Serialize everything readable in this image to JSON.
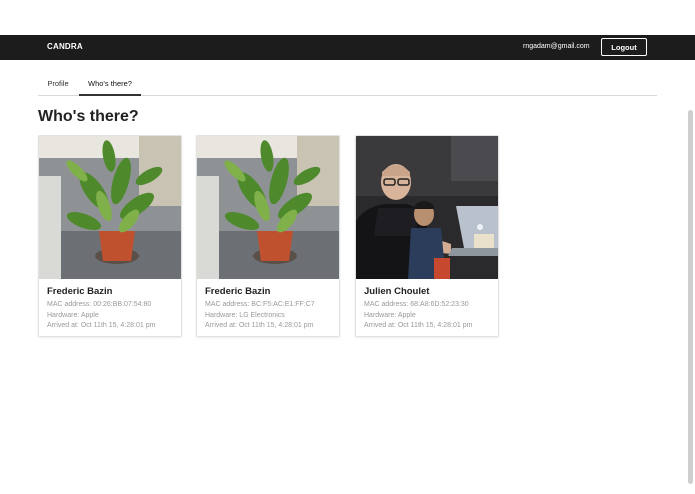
{
  "navbar": {
    "brand": "CANDRA",
    "user_email": "rngadam@gmail.com",
    "logout_label": "Logout"
  },
  "tabs": [
    {
      "label": "Profile",
      "active": false
    },
    {
      "label": "Who's there?",
      "active": true
    }
  ],
  "page": {
    "title": "Who's there?"
  },
  "cards": [
    {
      "name": "Frederic Bazin",
      "mac": "MAC address: 00:26:BB:07:54:80",
      "hardware": "Hardware: Apple",
      "arrived": "Arrived at: Oct 11th 15, 4:28:01 pm",
      "photo": "potted-plant-photo"
    },
    {
      "name": "Frederic Bazin",
      "mac": "MAC address: BC:F5:AC:E1:FF:C7",
      "hardware": "Hardware: LG Electronics",
      "arrived": "Arrived at: Oct 11th 15, 4:28:01 pm",
      "photo": "potted-plant-photo"
    },
    {
      "name": "Julien Choulet",
      "mac": "MAC address: 68:A8:6D:52:23:30",
      "hardware": "Hardware: Apple",
      "arrived": "Arrived at: Oct 11th 15, 4:28:01 pm",
      "photo": "person-at-laptop-photo"
    }
  ],
  "colors": {
    "navbar_bg": "#1c1c1c",
    "card_text_muted": "#999999"
  }
}
